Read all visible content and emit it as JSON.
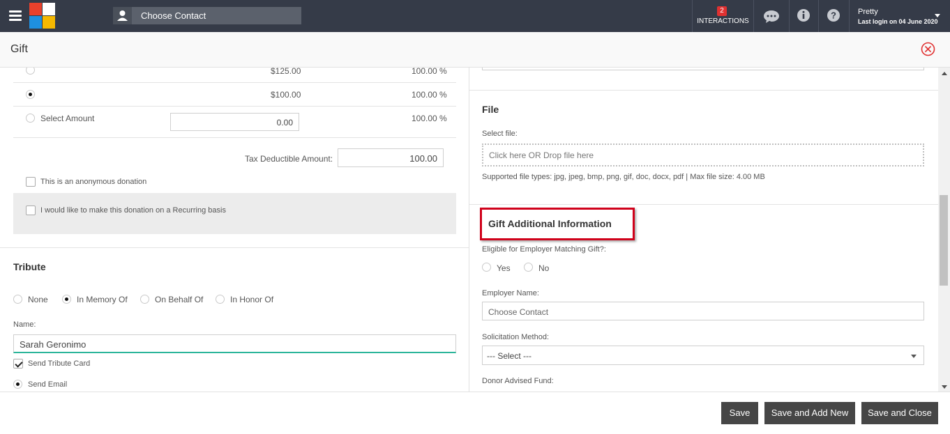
{
  "topbar": {
    "search_placeholder": "Choose Contact",
    "interactions_count": "2",
    "interactions_label": "INTERACTIONS",
    "user_name": "Pretty",
    "last_login": "Last login on 04 June 2020",
    "icons": [
      "menu-icon",
      "chat-icon",
      "info-icon",
      "help-icon"
    ],
    "logo_colors": [
      "#e8412c",
      "#ffffff",
      "#1e90e0",
      "#f5b800"
    ]
  },
  "header": {
    "title": "Gift"
  },
  "amounts": {
    "rows": [
      {
        "amount": "$125.00",
        "percent": "100.00 %"
      },
      {
        "amount": "$100.00",
        "percent": "100.00 %"
      }
    ],
    "select_label": "Select Amount",
    "select_value": "0.00",
    "select_percent": "100.00 %",
    "tax_label": "Tax Deductible Amount:",
    "tax_value": "100.00",
    "anonymous_label": "This is an anonymous donation",
    "recurring_label": "I would like to make this donation on a Recurring basis"
  },
  "tribute": {
    "title": "Tribute",
    "options": [
      "None",
      "In Memory Of",
      "On Behalf Of",
      "In Honor Of"
    ],
    "name_label": "Name:",
    "name_value": "Sarah Geronimo",
    "send_card_label": "Send Tribute Card",
    "send_email_label": "Send Email"
  },
  "file": {
    "title": "File",
    "select_label": "Select file:",
    "drop_text": "Click here OR Drop file here",
    "supported": "Supported file types: jpg, jpeg, bmp, png, gif, doc, docx, pdf | Max file size: 4.00 MB"
  },
  "additional": {
    "title": "Gift Additional Information",
    "matching_label": "Eligible for Employer Matching Gift?:",
    "yes": "Yes",
    "no": "No",
    "employer_label": "Employer Name:",
    "employer_placeholder": "Choose Contact",
    "solicitation_label": "Solicitation Method:",
    "solicitation_value": "--- Select ---",
    "donor_advised_label": "Donor Advised Fund:",
    "highlight_color": "#d0021b"
  },
  "footer": {
    "save": "Save",
    "save_add": "Save and Add New",
    "save_close": "Save and Close"
  }
}
